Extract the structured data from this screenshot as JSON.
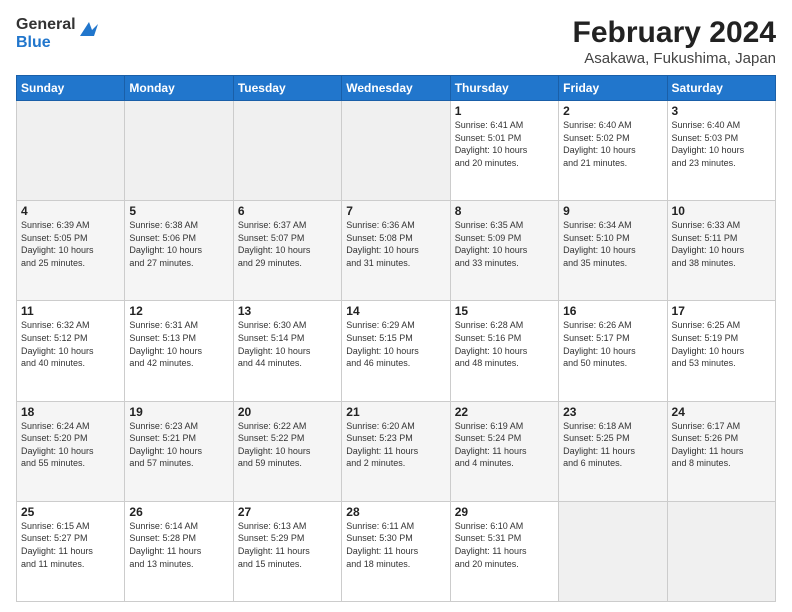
{
  "header": {
    "logo": {
      "line1": "General",
      "line2": "Blue"
    },
    "title": "February 2024",
    "subtitle": "Asakawa, Fukushima, Japan"
  },
  "days_of_week": [
    "Sunday",
    "Monday",
    "Tuesday",
    "Wednesday",
    "Thursday",
    "Friday",
    "Saturday"
  ],
  "weeks": [
    [
      {
        "day": "",
        "info": ""
      },
      {
        "day": "",
        "info": ""
      },
      {
        "day": "",
        "info": ""
      },
      {
        "day": "",
        "info": ""
      },
      {
        "day": "1",
        "info": "Sunrise: 6:41 AM\nSunset: 5:01 PM\nDaylight: 10 hours\nand 20 minutes."
      },
      {
        "day": "2",
        "info": "Sunrise: 6:40 AM\nSunset: 5:02 PM\nDaylight: 10 hours\nand 21 minutes."
      },
      {
        "day": "3",
        "info": "Sunrise: 6:40 AM\nSunset: 5:03 PM\nDaylight: 10 hours\nand 23 minutes."
      }
    ],
    [
      {
        "day": "4",
        "info": "Sunrise: 6:39 AM\nSunset: 5:05 PM\nDaylight: 10 hours\nand 25 minutes."
      },
      {
        "day": "5",
        "info": "Sunrise: 6:38 AM\nSunset: 5:06 PM\nDaylight: 10 hours\nand 27 minutes."
      },
      {
        "day": "6",
        "info": "Sunrise: 6:37 AM\nSunset: 5:07 PM\nDaylight: 10 hours\nand 29 minutes."
      },
      {
        "day": "7",
        "info": "Sunrise: 6:36 AM\nSunset: 5:08 PM\nDaylight: 10 hours\nand 31 minutes."
      },
      {
        "day": "8",
        "info": "Sunrise: 6:35 AM\nSunset: 5:09 PM\nDaylight: 10 hours\nand 33 minutes."
      },
      {
        "day": "9",
        "info": "Sunrise: 6:34 AM\nSunset: 5:10 PM\nDaylight: 10 hours\nand 35 minutes."
      },
      {
        "day": "10",
        "info": "Sunrise: 6:33 AM\nSunset: 5:11 PM\nDaylight: 10 hours\nand 38 minutes."
      }
    ],
    [
      {
        "day": "11",
        "info": "Sunrise: 6:32 AM\nSunset: 5:12 PM\nDaylight: 10 hours\nand 40 minutes."
      },
      {
        "day": "12",
        "info": "Sunrise: 6:31 AM\nSunset: 5:13 PM\nDaylight: 10 hours\nand 42 minutes."
      },
      {
        "day": "13",
        "info": "Sunrise: 6:30 AM\nSunset: 5:14 PM\nDaylight: 10 hours\nand 44 minutes."
      },
      {
        "day": "14",
        "info": "Sunrise: 6:29 AM\nSunset: 5:15 PM\nDaylight: 10 hours\nand 46 minutes."
      },
      {
        "day": "15",
        "info": "Sunrise: 6:28 AM\nSunset: 5:16 PM\nDaylight: 10 hours\nand 48 minutes."
      },
      {
        "day": "16",
        "info": "Sunrise: 6:26 AM\nSunset: 5:17 PM\nDaylight: 10 hours\nand 50 minutes."
      },
      {
        "day": "17",
        "info": "Sunrise: 6:25 AM\nSunset: 5:19 PM\nDaylight: 10 hours\nand 53 minutes."
      }
    ],
    [
      {
        "day": "18",
        "info": "Sunrise: 6:24 AM\nSunset: 5:20 PM\nDaylight: 10 hours\nand 55 minutes."
      },
      {
        "day": "19",
        "info": "Sunrise: 6:23 AM\nSunset: 5:21 PM\nDaylight: 10 hours\nand 57 minutes."
      },
      {
        "day": "20",
        "info": "Sunrise: 6:22 AM\nSunset: 5:22 PM\nDaylight: 10 hours\nand 59 minutes."
      },
      {
        "day": "21",
        "info": "Sunrise: 6:20 AM\nSunset: 5:23 PM\nDaylight: 11 hours\nand 2 minutes."
      },
      {
        "day": "22",
        "info": "Sunrise: 6:19 AM\nSunset: 5:24 PM\nDaylight: 11 hours\nand 4 minutes."
      },
      {
        "day": "23",
        "info": "Sunrise: 6:18 AM\nSunset: 5:25 PM\nDaylight: 11 hours\nand 6 minutes."
      },
      {
        "day": "24",
        "info": "Sunrise: 6:17 AM\nSunset: 5:26 PM\nDaylight: 11 hours\nand 8 minutes."
      }
    ],
    [
      {
        "day": "25",
        "info": "Sunrise: 6:15 AM\nSunset: 5:27 PM\nDaylight: 11 hours\nand 11 minutes."
      },
      {
        "day": "26",
        "info": "Sunrise: 6:14 AM\nSunset: 5:28 PM\nDaylight: 11 hours\nand 13 minutes."
      },
      {
        "day": "27",
        "info": "Sunrise: 6:13 AM\nSunset: 5:29 PM\nDaylight: 11 hours\nand 15 minutes."
      },
      {
        "day": "28",
        "info": "Sunrise: 6:11 AM\nSunset: 5:30 PM\nDaylight: 11 hours\nand 18 minutes."
      },
      {
        "day": "29",
        "info": "Sunrise: 6:10 AM\nSunset: 5:31 PM\nDaylight: 11 hours\nand 20 minutes."
      },
      {
        "day": "",
        "info": ""
      },
      {
        "day": "",
        "info": ""
      }
    ]
  ]
}
